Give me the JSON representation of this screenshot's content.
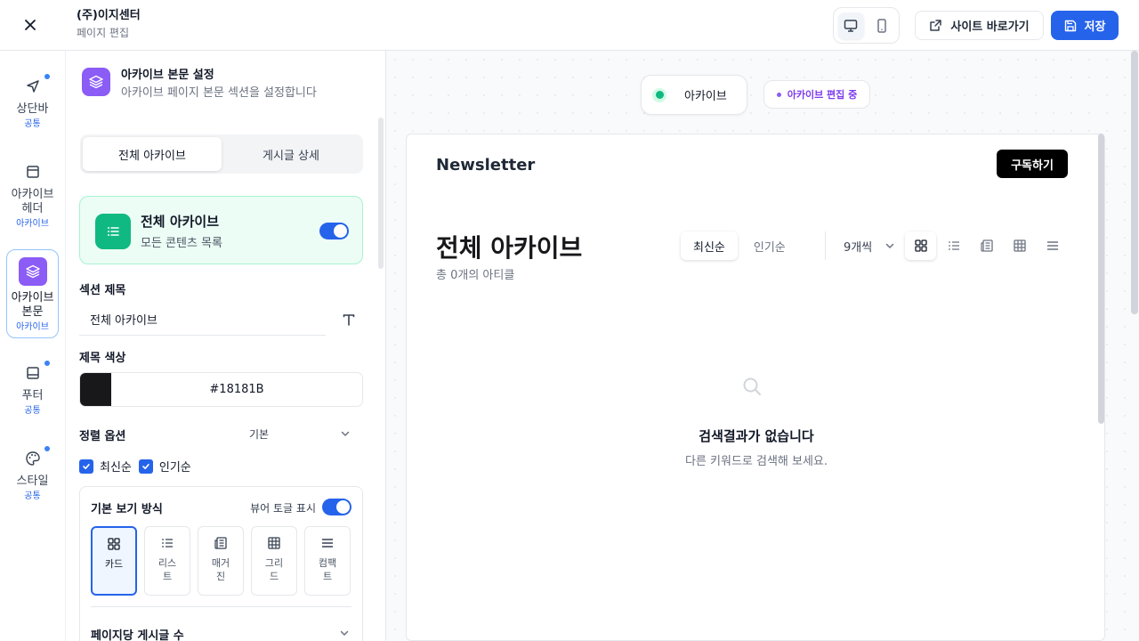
{
  "header": {
    "company": "(주)이지센터",
    "subtitle": "페이지 편집",
    "site_link_label": "사이트 바로가기",
    "save_label": "저장"
  },
  "rail": {
    "items": [
      {
        "label": "상단바",
        "tag": "공통",
        "icon": "navigation-icon"
      },
      {
        "label": "아카이브 헤더",
        "tag": "아카이브",
        "icon": "layout-icon"
      },
      {
        "label": "아카이브 본문",
        "tag": "아카이브",
        "icon": "layers-icon"
      },
      {
        "label": "푸터",
        "tag": "공통",
        "icon": "footer-icon"
      },
      {
        "label": "스타일",
        "tag": "공통",
        "icon": "palette-icon"
      }
    ]
  },
  "panel": {
    "title": "아카이브 본문 설정",
    "subtitle": "아카이브 페이지 본문 섹션을 설정합니다",
    "tabs": [
      "전체 아카이브",
      "게시글 상세"
    ],
    "archive_card": {
      "title": "전체 아카이브",
      "subtitle": "모든 콘텐츠 목록"
    },
    "section_title_label": "섹션 제목",
    "section_title_value": "전체 아카이브",
    "title_color_label": "제목 색상",
    "title_color_value": "#18181B",
    "sort_label": "정렬 옵션",
    "sort_value": "기본",
    "checks": [
      "최신순",
      "인기순"
    ],
    "view_mode_label": "기본 보기 방식",
    "viewer_toggle_label": "뷰어 토글 표시",
    "view_options": [
      {
        "label": "카드",
        "icon": "grid-icon"
      },
      {
        "label": "리스트",
        "icon": "list-icon"
      },
      {
        "label": "매거진",
        "icon": "magazine-icon"
      },
      {
        "label": "그리드",
        "icon": "table-icon"
      },
      {
        "label": "컴팩트",
        "icon": "compact-icon"
      }
    ],
    "per_page_label": "페이지당 게시글 수"
  },
  "preview": {
    "section_pill": "아카이브",
    "editing_pill": "아카이브 편집 중",
    "brand": "Newsletter",
    "subscribe": "구독하기",
    "title": "전체 아카이브",
    "count_text": "총 0개의 아티클",
    "sort_tabs": [
      "최신순",
      "인기순"
    ],
    "per_page": "9개씩",
    "empty_title": "검색결과가 없습니다",
    "empty_sub": "다른 키워드로 검색해 보세요."
  },
  "colors": {
    "accent": "#2563eb",
    "purple": "#8b5cf6",
    "green": "#10b981",
    "title": "#18181B"
  }
}
